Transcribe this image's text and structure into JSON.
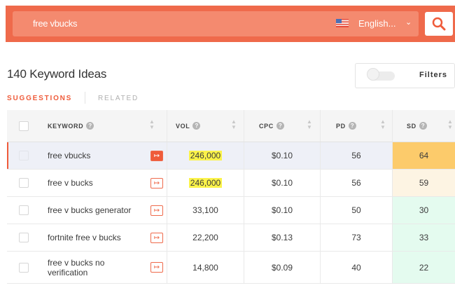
{
  "search": {
    "query": "free vbucks",
    "language": "English...",
    "language_flag": "us-flag-icon"
  },
  "header": {
    "title": "140 Keyword Ideas",
    "filters_label": "Filters"
  },
  "tabs": [
    {
      "label": "SUGGESTIONS",
      "active": true
    },
    {
      "label": "RELATED",
      "active": false
    }
  ],
  "table": {
    "columns": [
      {
        "key": "keyword",
        "label": "KEYWORD"
      },
      {
        "key": "vol",
        "label": "VOL"
      },
      {
        "key": "cpc",
        "label": "CPC"
      },
      {
        "key": "pd",
        "label": "PD"
      },
      {
        "key": "sd",
        "label": "SD"
      }
    ],
    "rows": [
      {
        "keyword": "free vbucks",
        "vol": "246,000",
        "cpc": "$0.10",
        "pd": "56",
        "sd": "64",
        "selected": true,
        "vol_highlight": true,
        "sd_color": "#fccb6b"
      },
      {
        "keyword": "free v bucks",
        "vol": "246,000",
        "cpc": "$0.10",
        "pd": "56",
        "sd": "59",
        "selected": false,
        "vol_highlight": true,
        "sd_color": "#fdf4e3"
      },
      {
        "keyword": "free v bucks generator",
        "vol": "33,100",
        "cpc": "$0.10",
        "pd": "50",
        "sd": "30",
        "selected": false,
        "vol_highlight": false,
        "sd_color": "#e4fbef"
      },
      {
        "keyword": "fortnite free v bucks",
        "vol": "22,200",
        "cpc": "$0.13",
        "pd": "73",
        "sd": "33",
        "selected": false,
        "vol_highlight": false,
        "sd_color": "#e4fbef"
      },
      {
        "keyword": "free v bucks no verification",
        "vol": "14,800",
        "cpc": "$0.09",
        "pd": "40",
        "sd": "22",
        "selected": false,
        "vol_highlight": false,
        "sd_color": "#e4fbef"
      }
    ]
  },
  "colors": {
    "accent": "#ef5b3a",
    "bar": "#ef6a4b",
    "highlight": "#fbf34a"
  }
}
